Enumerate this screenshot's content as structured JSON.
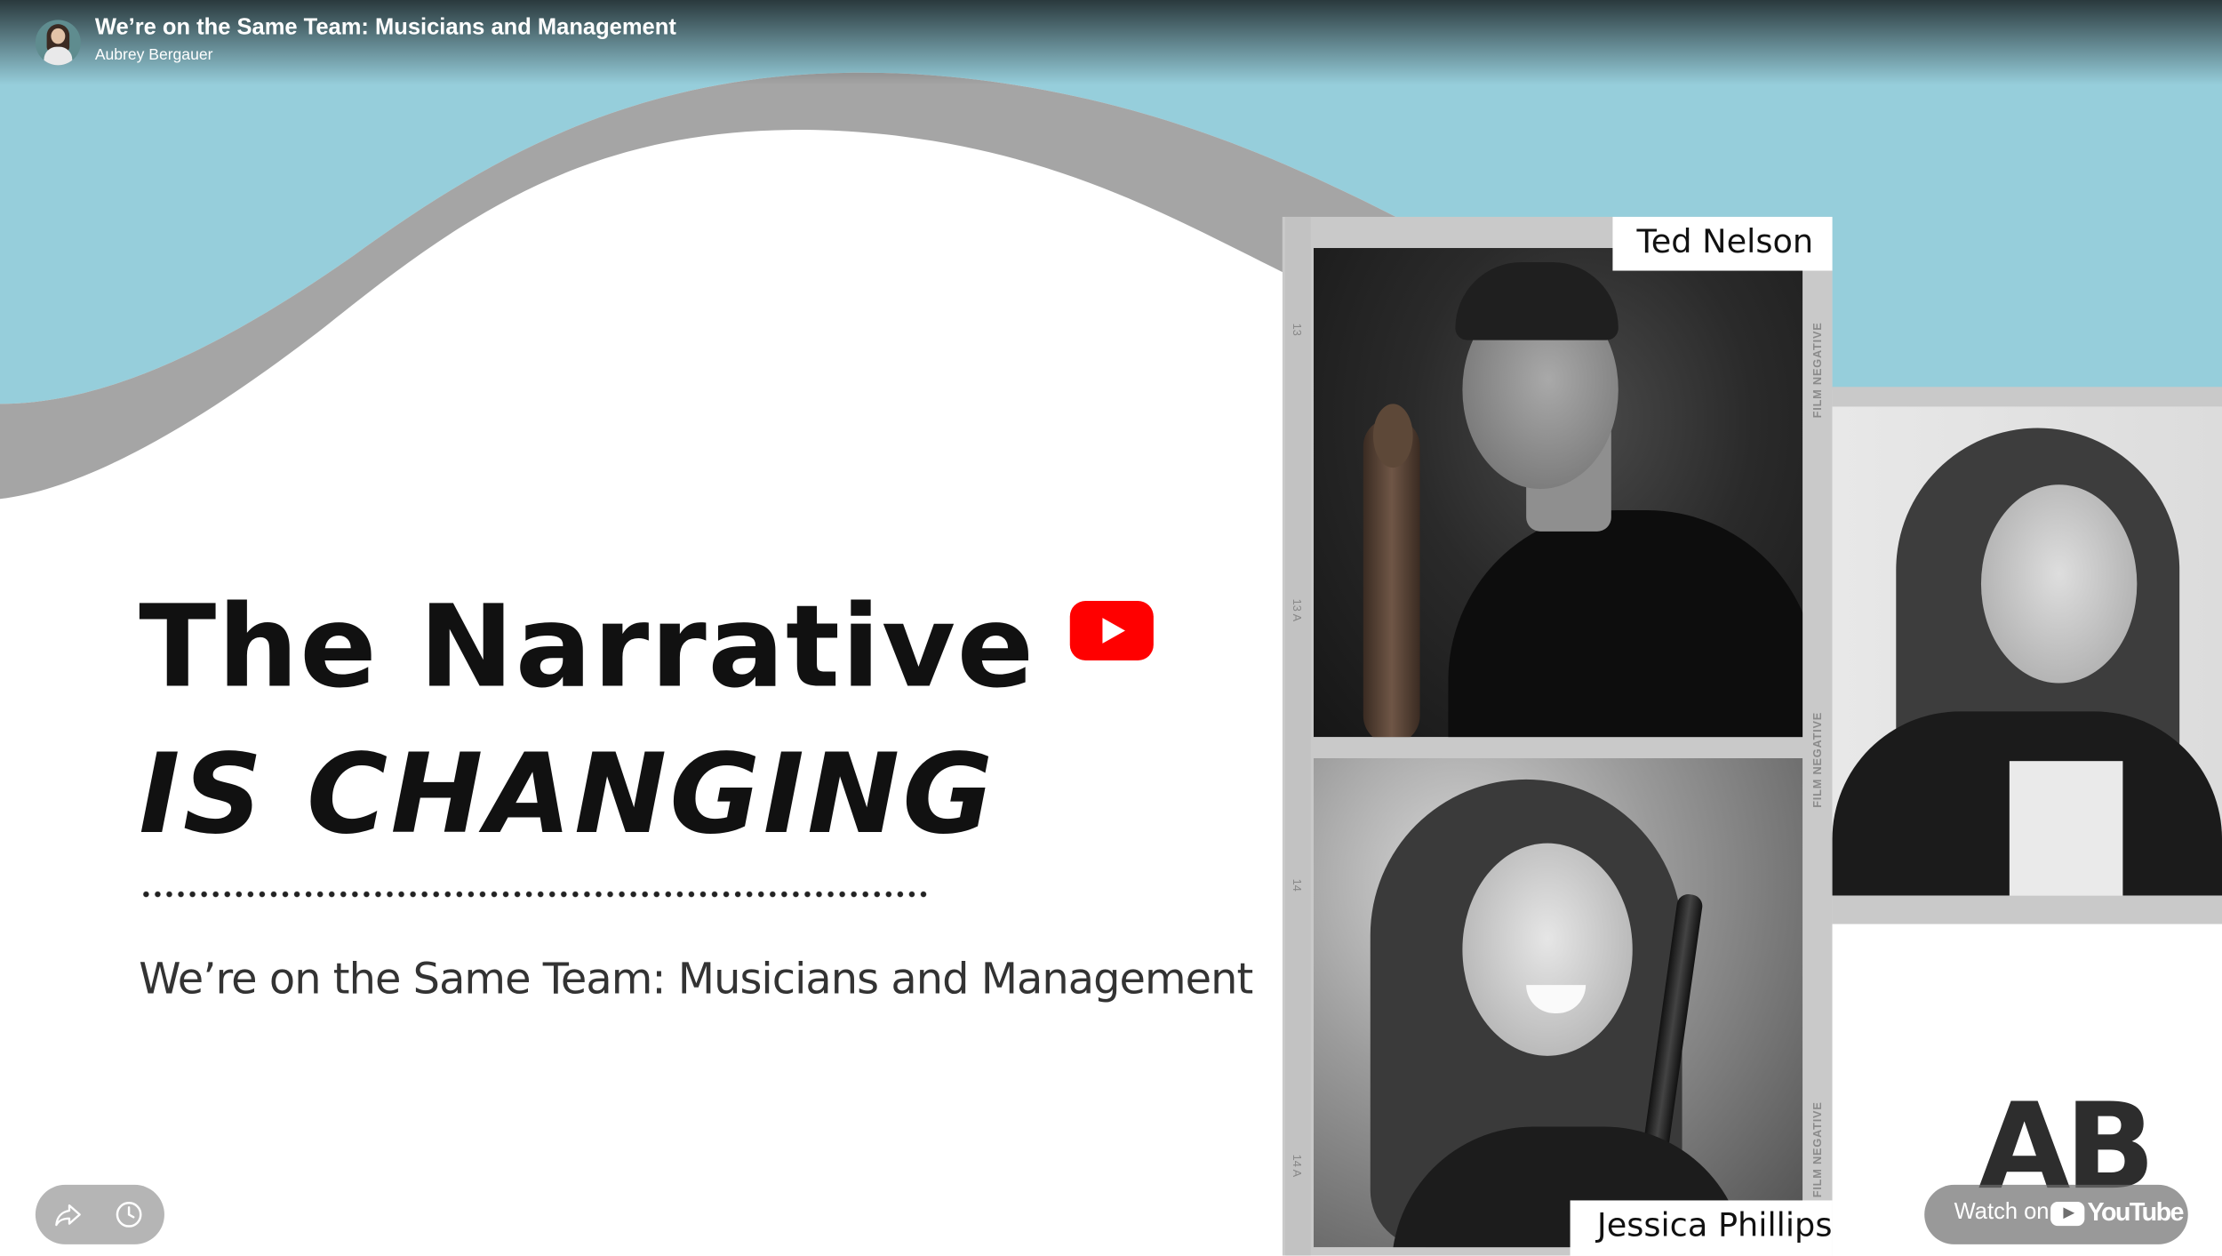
{
  "video": {
    "title": "We’re on the Same Team: Musicians and Management",
    "channel": "Aubrey Bergauer"
  },
  "slide": {
    "headline_line1": "The Narrative",
    "headline_line2": "IS CHANGING",
    "subtitle": "We’re on the Same Team: Musicians and Management",
    "speaker_1": "Ted Nelson",
    "speaker_2": "Jessica Phillips",
    "logo": "AB",
    "film_frames": [
      "13",
      "13 A",
      "14",
      "14 A"
    ],
    "film_label": "FILM NEGATIVE"
  },
  "controls": {
    "watch_on": "Watch on",
    "youtube": "YouTube"
  },
  "icons": {
    "share": "share-arrow-icon",
    "watch_later": "clock-icon",
    "play": "play-icon"
  },
  "colors": {
    "sky": "#96cedb",
    "wave_gray": "#a5a5a5",
    "youtube_red": "#ff0000"
  }
}
